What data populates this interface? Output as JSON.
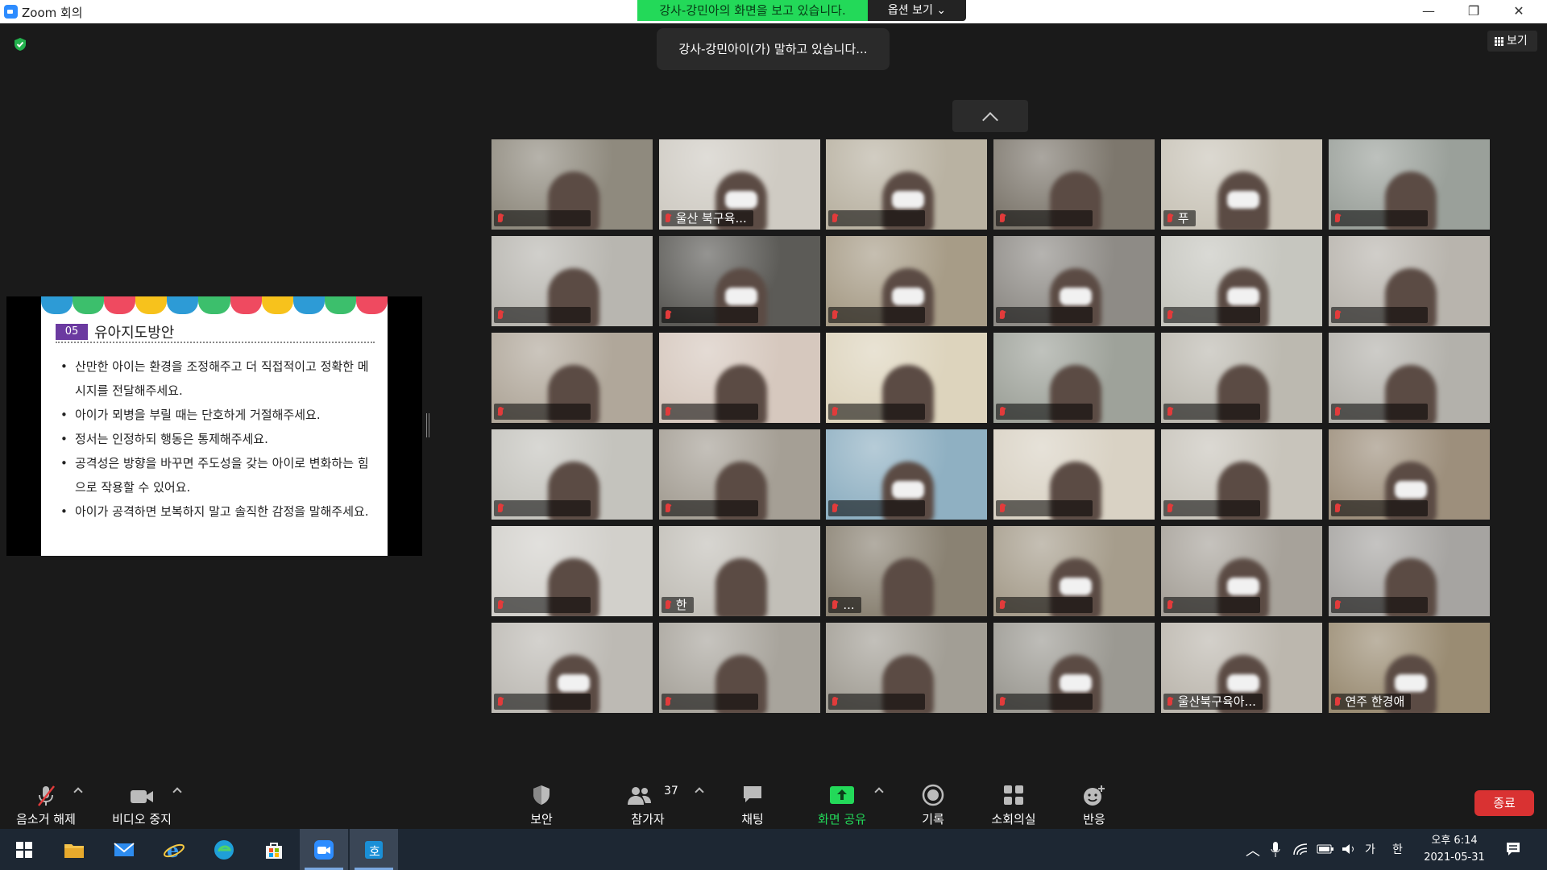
{
  "window": {
    "title": "Zoom 회의"
  },
  "viewing_banner": {
    "text": "강사-강민아의 화면을 보고 있습니다.",
    "options_label": "옵션 보기"
  },
  "view_button": {
    "label": "보기"
  },
  "talking_indicator": {
    "text": "강사-강민아이(가) 말하고 있습니다..."
  },
  "shared_slide": {
    "number": "05",
    "title": "유아지도방안",
    "bullets": [
      "산만한 아이는 환경을 조정해주고 더 직접적이고 정확한 메시지를 전달해주세요.",
      "아이가 뫼병을 부릴 때는 단호하게 거절해주세요.",
      "정서는 인정하되 행동은 통제해주세요.",
      "공격성은 방향을 바꾸면 주도성을 갖는 아이로 변화하는 힘으로 작용할 수 있어요.",
      "아이가 공격하면 보복하지 말고 솔직한 감정을 말해주세요."
    ]
  },
  "gallery": {
    "tiles": [
      {
        "name": "",
        "bg": "#8f8a7e",
        "mask": false
      },
      {
        "name": "울산 북구육...",
        "bg": "#cfcbc3",
        "mask": true
      },
      {
        "name": "",
        "bg": "#b9b2a2",
        "mask": true
      },
      {
        "name": "",
        "bg": "#7d776d",
        "mask": false
      },
      {
        "name": "푸",
        "bg": "#c9c4b8",
        "mask": true
      },
      {
        "name": "",
        "bg": "#9aa09a",
        "mask": false
      },
      {
        "name": "",
        "bg": "#b8b6b0",
        "mask": false
      },
      {
        "name": "",
        "bg": "#5c5b57",
        "mask": true
      },
      {
        "name": "",
        "bg": "#a79c87",
        "mask": true
      },
      {
        "name": "",
        "bg": "#8e8b86",
        "mask": true
      },
      {
        "name": "",
        "bg": "#c6c6bf",
        "mask": true
      },
      {
        "name": "",
        "bg": "#b8b4ad",
        "mask": false
      },
      {
        "name": "",
        "bg": "#b0a79a",
        "mask": false
      },
      {
        "name": "",
        "bg": "#d6c8be",
        "mask": false
      },
      {
        "name": "",
        "bg": "#ddd4bd",
        "mask": false
      },
      {
        "name": "",
        "bg": "#9ea29a",
        "mask": false
      },
      {
        "name": "",
        "bg": "#bcb9b0",
        "mask": false
      },
      {
        "name": "",
        "bg": "#b3b1ab",
        "mask": false
      },
      {
        "name": "",
        "bg": "#c4c3bd",
        "mask": false
      },
      {
        "name": "",
        "bg": "#a59f95",
        "mask": false
      },
      {
        "name": "",
        "bg": "#8fb0c2",
        "mask": true
      },
      {
        "name": "",
        "bg": "#d9d2c4",
        "mask": false
      },
      {
        "name": "",
        "bg": "#c8c4bb",
        "mask": false
      },
      {
        "name": "",
        "bg": "#9d8f7c",
        "mask": true
      },
      {
        "name": "",
        "bg": "#d2d0cb",
        "mask": false
      },
      {
        "name": "한",
        "bg": "#c2bfb8",
        "mask": false
      },
      {
        "name": "...",
        "bg": "#8a8273",
        "mask": false
      },
      {
        "name": "",
        "bg": "#a69d8c",
        "mask": true
      },
      {
        "name": "",
        "bg": "#a7a29a",
        "mask": true
      },
      {
        "name": "",
        "bg": "#a6a4a1",
        "mask": false
      },
      {
        "name": "",
        "bg": "#bdbab4",
        "mask": true
      },
      {
        "name": "",
        "bg": "#a8a49c",
        "mask": false
      },
      {
        "name": "",
        "bg": "#a29e95",
        "mask": false
      },
      {
        "name": "",
        "bg": "#9b9992",
        "mask": true
      },
      {
        "name": "울산북구육아...",
        "bg": "#bcb7ae",
        "mask": true
      },
      {
        "name": "연주 한경애",
        "bg": "#9a8c73",
        "mask": true
      }
    ]
  },
  "toolbar": {
    "mute_label": "음소거 해제",
    "video_label": "비디오 중지",
    "security_label": "보안",
    "participants_label": "참가자",
    "participants_count": "37",
    "chat_label": "채팅",
    "share_label": "화면 공유",
    "record_label": "기록",
    "breakout_label": "소회의실",
    "reactions_label": "반응",
    "end_label": "종료"
  },
  "taskbar": {
    "apps": [
      "windows-start",
      "file-explorer",
      "mail",
      "internet-explorer",
      "edge",
      "store",
      "zoom",
      "app"
    ],
    "ime_lang": "가",
    "ime_mode": "한",
    "time": "오후 6:14",
    "date": "2021-05-31"
  },
  "colors": {
    "banner_green": "#23d959",
    "share_green": "#23d959",
    "end_red": "#d93232",
    "scallops": [
      "#2d9bd6",
      "#3cbf6c",
      "#ef4a60",
      "#f7c21c",
      "#2d9bd6",
      "#3cbf6c",
      "#ef4a60",
      "#f7c21c",
      "#2d9bd6",
      "#3cbf6c",
      "#ef4a60"
    ]
  }
}
